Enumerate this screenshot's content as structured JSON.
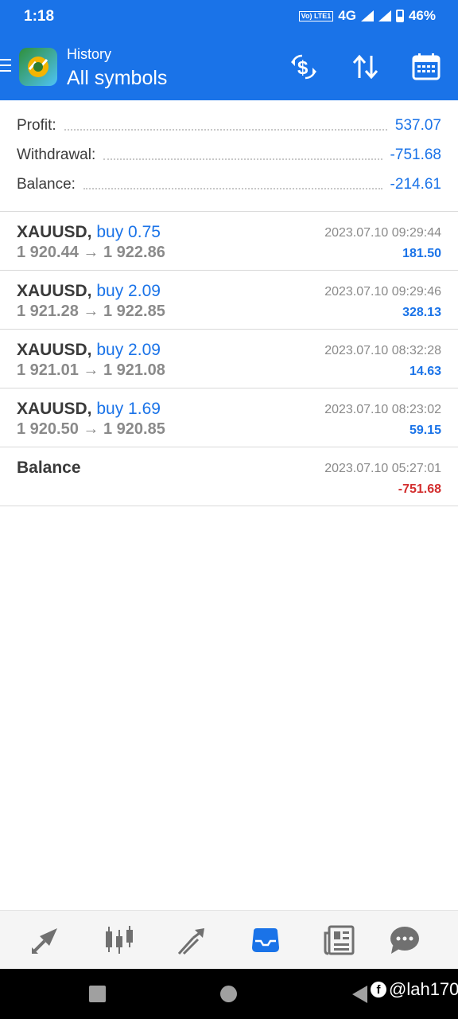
{
  "status_bar": {
    "time": "1:18",
    "volte_label": "Vo) LTE1",
    "network": "4G",
    "battery": "46%"
  },
  "header": {
    "subtitle": "History",
    "title": "All symbols",
    "icons": [
      "dollar-refresh-icon",
      "sort-icon",
      "calendar-icon"
    ]
  },
  "summary": {
    "profit_label": "Profit:",
    "profit_value": "537.07",
    "withdrawal_label": "Withdrawal:",
    "withdrawal_value": "-751.68",
    "balance_label": "Balance:",
    "balance_value": "-214.61"
  },
  "deals": [
    {
      "symbol": "XAUUSD,",
      "direction": "buy 0.75",
      "prices": "1 920.44 → 1 922.86",
      "time": "2023.07.10 09:29:44",
      "profit": "181.50"
    },
    {
      "symbol": "XAUUSD,",
      "direction": "buy 2.09",
      "prices": "1 921.28 → 1 922.85",
      "time": "2023.07.10 09:29:46",
      "profit": "328.13"
    },
    {
      "symbol": "XAUUSD,",
      "direction": "buy 2.09",
      "prices": "1 921.01 → 1 921.08",
      "time": "2023.07.10 08:32:28",
      "profit": "14.63"
    },
    {
      "symbol": "XAUUSD,",
      "direction": "buy 1.69",
      "prices": "1 920.50 → 1 920.85",
      "time": "2023.07.10 08:23:02",
      "profit": "59.15"
    }
  ],
  "balance_entry": {
    "label": "Balance",
    "time": "2023.07.10 05:27:01",
    "amount": "-751.68"
  },
  "bottom_nav": [
    "quotes-icon",
    "chart-icon",
    "trade-icon",
    "history-icon",
    "news-icon",
    "messages-icon"
  ],
  "colors": {
    "accent": "#1a73e8",
    "negative": "#d32f2f",
    "muted": "#8a8a8a"
  },
  "watermark": "@lah170"
}
